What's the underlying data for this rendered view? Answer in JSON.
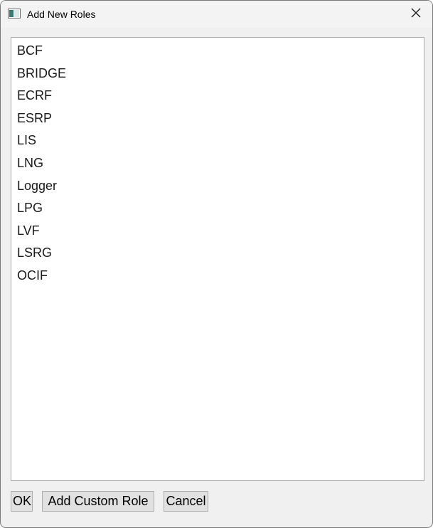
{
  "window": {
    "title": "Add New Roles"
  },
  "icons": {
    "app": "app-window-icon",
    "close": "close-icon"
  },
  "roles": [
    "BCF",
    "BRIDGE",
    "ECRF",
    "ESRP",
    "LIS",
    "LNG",
    "Logger",
    "LPG",
    "LVF",
    "LSRG",
    "OCIF"
  ],
  "buttons": {
    "ok": "OK",
    "add_custom": "Add Custom Role",
    "cancel": "Cancel"
  }
}
